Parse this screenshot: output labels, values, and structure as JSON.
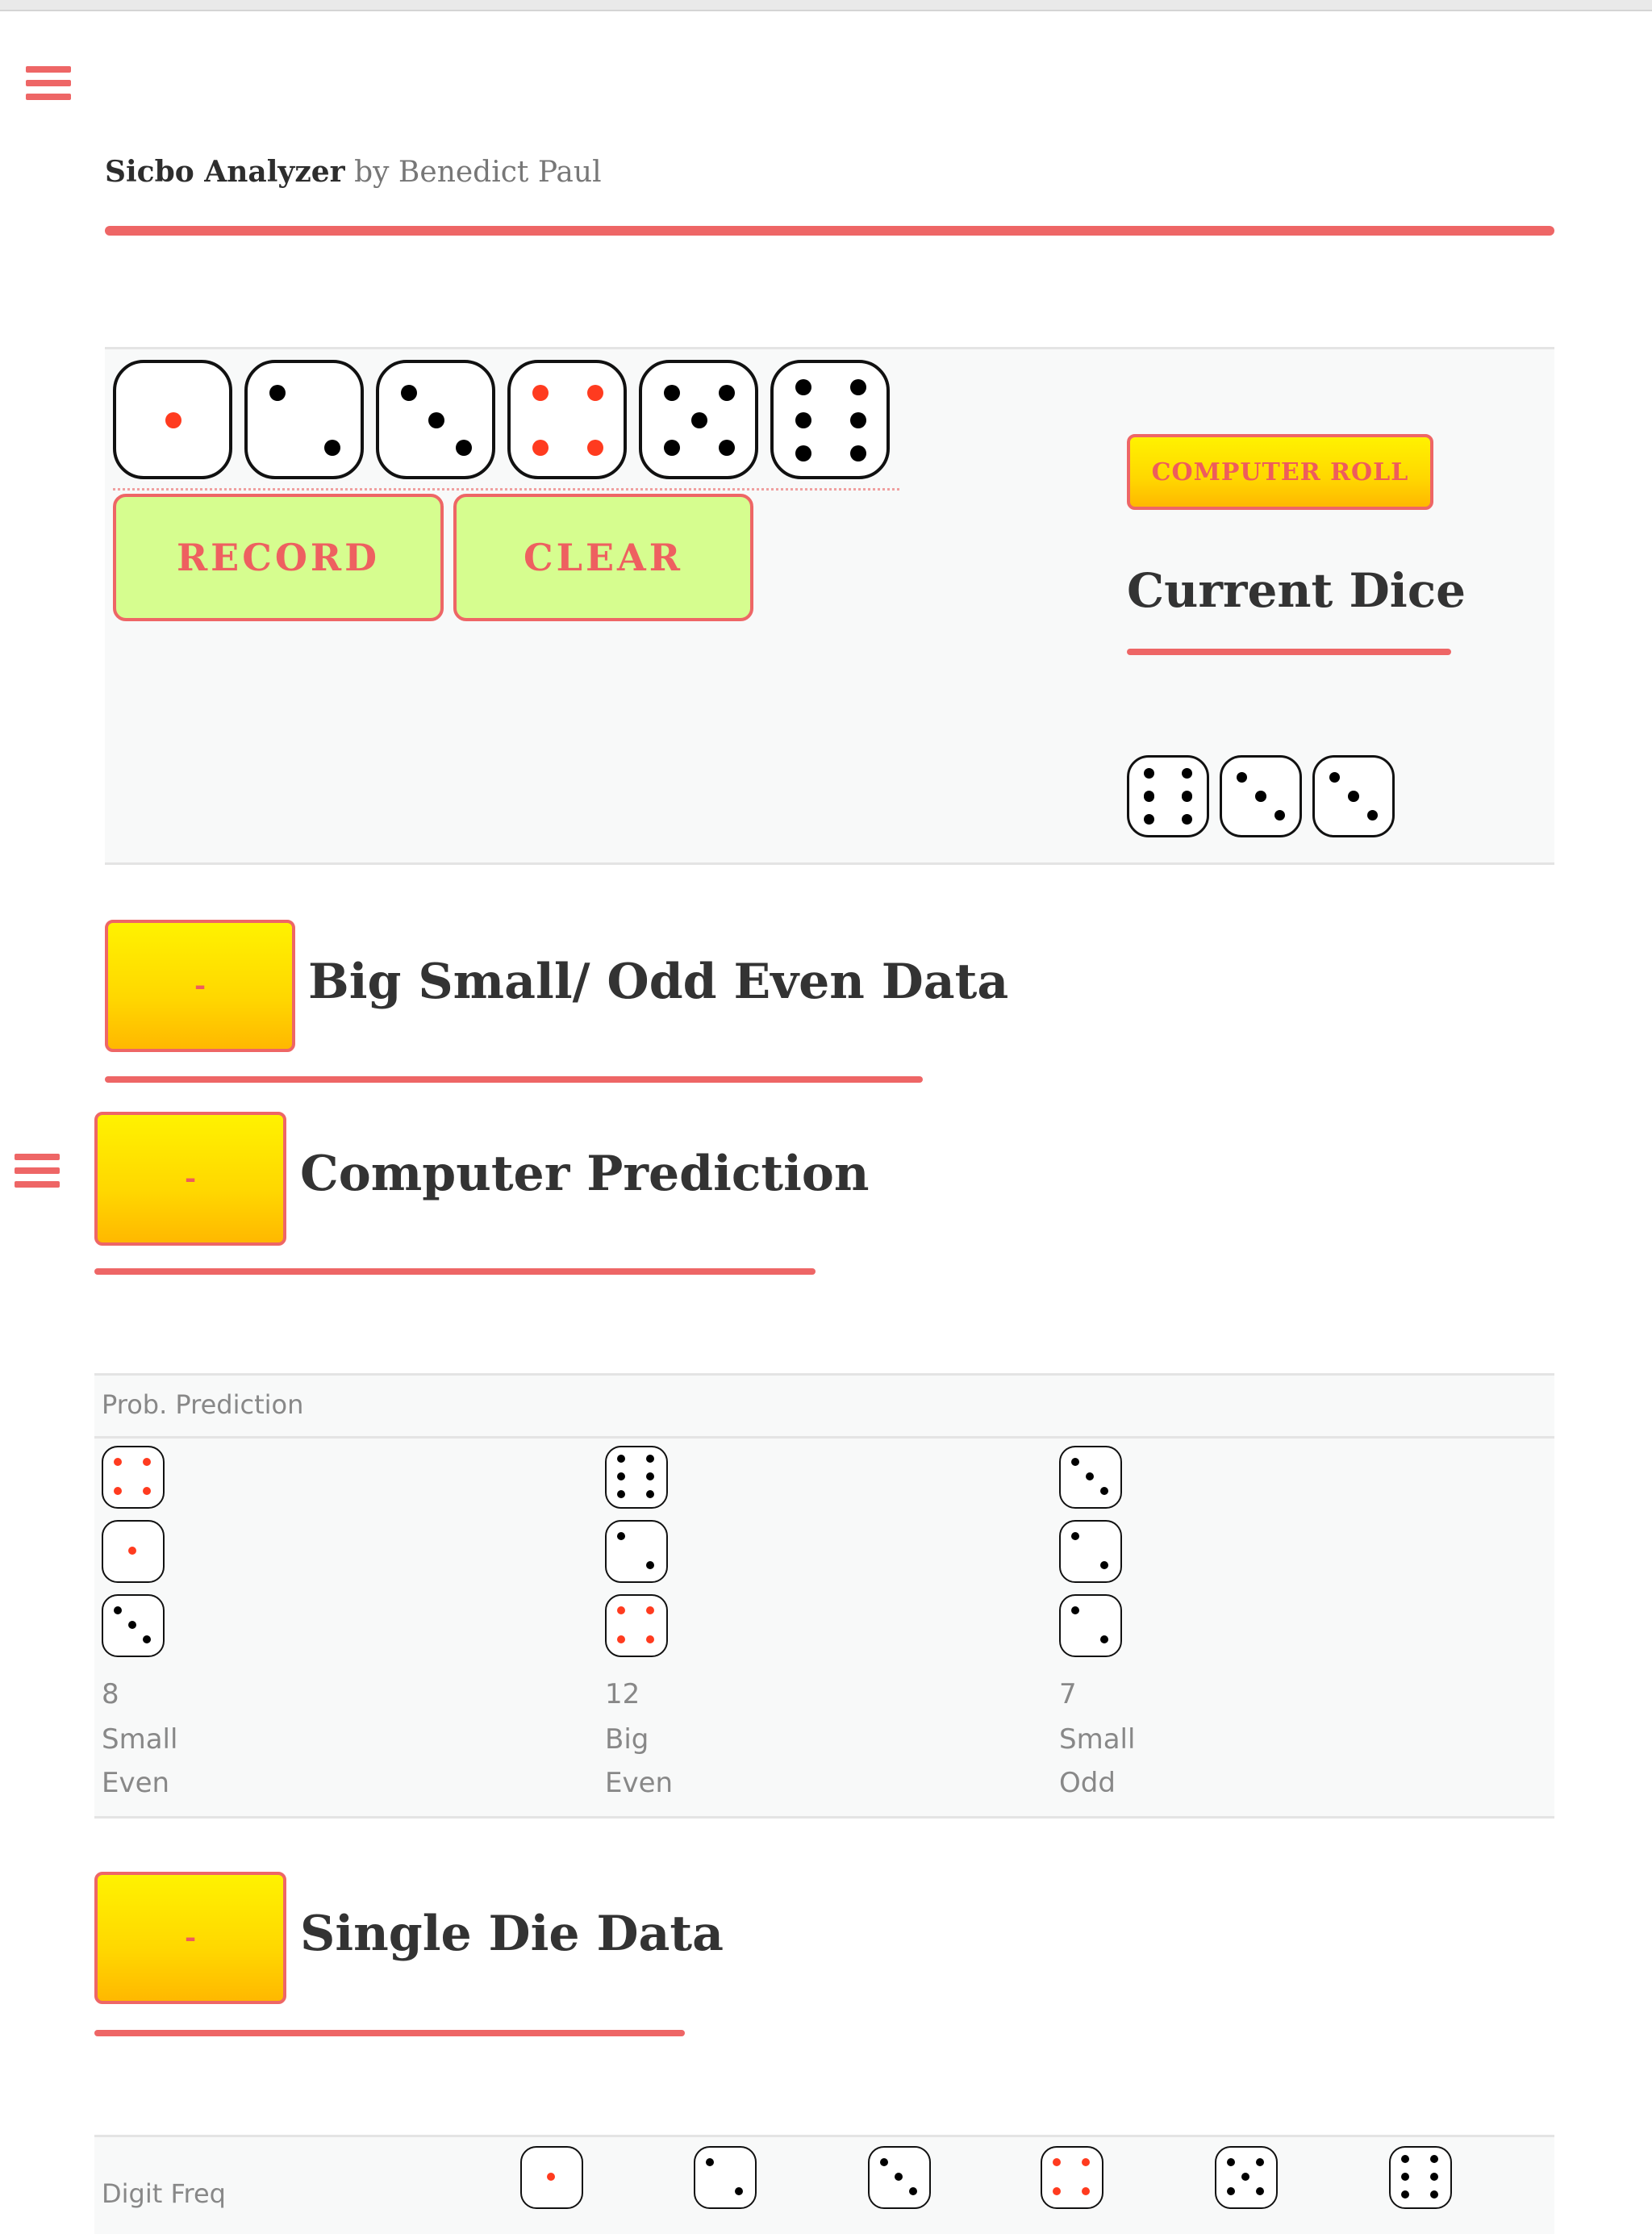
{
  "app": {
    "name": "Sicbo Analyzer",
    "byline": "by Benedict Paul"
  },
  "colors": {
    "accent": "#ee6666",
    "record_button": "#d6fd8f",
    "yellow_button": "#ffd700",
    "red_pip": "#ff3b1f"
  },
  "input_panel": {
    "selector_dice": [
      1,
      2,
      3,
      4,
      5,
      6
    ],
    "record_label": "RECORD",
    "clear_label": "CLEAR",
    "computer_roll_label": "COMPUTER ROLL",
    "current_dice_title": "Current Dice",
    "current_dice": [
      6,
      3,
      3
    ]
  },
  "sections": {
    "big_small": {
      "toggle_label": "-",
      "title": "Big Small/ Odd Even Data"
    },
    "prediction": {
      "toggle_label": "-",
      "title": "Computer Prediction"
    },
    "single_die": {
      "toggle_label": "-",
      "title": "Single Die Data"
    }
  },
  "prob_prediction": {
    "header": "Prob. Prediction",
    "columns": [
      {
        "dice": [
          4,
          1,
          3
        ],
        "total": "8",
        "size": "Small",
        "parity": "Even"
      },
      {
        "dice": [
          6,
          2,
          4
        ],
        "total": "12",
        "size": "Big",
        "parity": "Even"
      },
      {
        "dice": [
          3,
          2,
          2
        ],
        "total": "7",
        "size": "Small",
        "parity": "Odd"
      }
    ]
  },
  "digit_freq": {
    "header": "Digit Freq",
    "dice": [
      1,
      2,
      3,
      4,
      5,
      6
    ]
  }
}
